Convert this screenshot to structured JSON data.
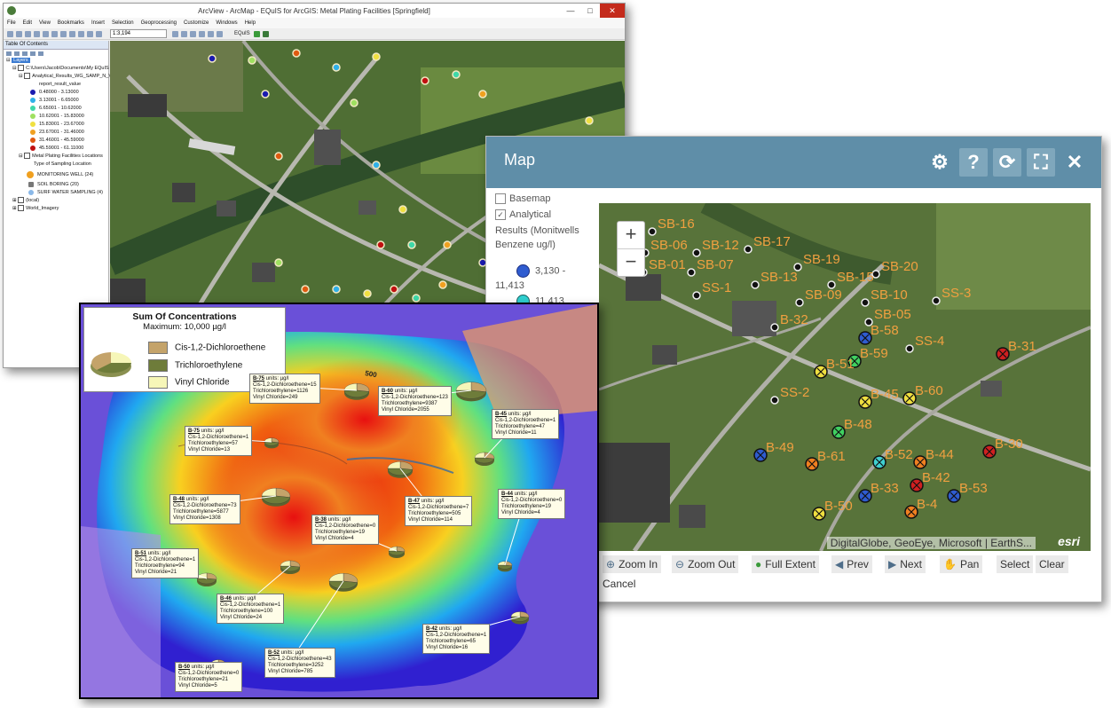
{
  "arcmap": {
    "title": "ArcView - ArcMap - EQuIS for ArcGIS: Metal Plating Facilities [Springfield]",
    "menus": [
      "File",
      "Edit",
      "View",
      "Bookmarks",
      "Insert",
      "Selection",
      "Geoprocessing",
      "Customize",
      "Windows",
      "Help"
    ],
    "scale": "1:3,194",
    "equis_label": "EQuIS",
    "toc": {
      "header": "Table Of Contents",
      "layers_label": "Layers",
      "path": "C:\\Users\\Jacob\\Documents\\My EQuIS",
      "analytical_layer": "Analytical_Results_WG_SAMP_N_Va",
      "field": "report_result_value",
      "classes": [
        {
          "range": "0.48000 - 3.13000",
          "color": "#1a1ab0"
        },
        {
          "range": "3.13001 - 6.65000",
          "color": "#2fb0e8"
        },
        {
          "range": "6.65001 - 10.62000",
          "color": "#3fd8a8"
        },
        {
          "range": "10.62001 - 15.83000",
          "color": "#9fe060"
        },
        {
          "range": "15.83001 - 23.67000",
          "color": "#f0e040"
        },
        {
          "range": "23.67001 - 31.46000",
          "color": "#f0a020"
        },
        {
          "range": "31.46001 - 45.59000",
          "color": "#e05a10"
        },
        {
          "range": "45.59001 - 61.11000",
          "color": "#c01010"
        }
      ],
      "locations_layer": "Metal Plating Facilities Locations",
      "type_field": "Type of Sampling Location",
      "location_types": [
        "MONITORING WELL (24)",
        "SOIL BORING (20)",
        "SURF WATER SAMPLING (4)"
      ],
      "other_layers": [
        "(local)",
        "World_Imagery"
      ]
    }
  },
  "map_widget": {
    "title": "Map",
    "tools": [
      "gear-icon",
      "help-icon",
      "refresh-icon",
      "fullscreen-icon",
      "close-icon"
    ],
    "legend": {
      "basemap": "Basemap",
      "analytical": "Analytical",
      "results_label": "Results (Monitwells Benzene ug/l)",
      "class1": "3,130 -",
      "class1b": "11,413",
      "class2": "11,413"
    },
    "attribution": "DigitalGlobe, GeoEye, Microsoft | EarthS...",
    "esri": "esri",
    "buttons": [
      "Zoom In",
      "Zoom Out",
      "Full Extent",
      "Prev",
      "Next",
      "Pan",
      "Select",
      "Clear",
      "Cancel"
    ],
    "sample_labels": [
      {
        "t": "SB-16"
      },
      {
        "t": "SB-06"
      },
      {
        "t": "SB-12"
      },
      {
        "t": "SB-17"
      },
      {
        "t": "SB-01"
      },
      {
        "t": "SB-07"
      },
      {
        "t": "SB-19"
      },
      {
        "t": "SB-20"
      },
      {
        "t": "SB-13"
      },
      {
        "t": "SB-15"
      },
      {
        "t": "SS-1"
      },
      {
        "t": "SB-09"
      },
      {
        "t": "SB-10"
      },
      {
        "t": "SS-3"
      },
      {
        "t": "SB-05"
      },
      {
        "t": "B-32"
      },
      {
        "t": "B-58"
      },
      {
        "t": "SS-4"
      },
      {
        "t": "B-31"
      },
      {
        "t": "B-59"
      },
      {
        "t": "B-51"
      },
      {
        "t": "SS-2"
      },
      {
        "t": "B-60"
      },
      {
        "t": "B-45"
      },
      {
        "t": "B-48"
      },
      {
        "t": "B-49"
      },
      {
        "t": "B-30"
      },
      {
        "t": "B-61"
      },
      {
        "t": "B-52"
      },
      {
        "t": "B-44"
      },
      {
        "t": "B-42"
      },
      {
        "t": "B-33"
      },
      {
        "t": "B-53"
      },
      {
        "t": "B-4"
      },
      {
        "t": "B-50"
      }
    ]
  },
  "concentration_map": {
    "title": "Sum Of Concentrations",
    "subtitle": "Maximum: 10,000 µg/l",
    "legend": [
      {
        "label": "Cis-1,2-Dichloroethene",
        "color": "#c4a36a"
      },
      {
        "label": "Trichloroethylene",
        "color": "#6e7c3a"
      },
      {
        "label": "Vinyl Chloride",
        "color": "#f6f6b8"
      }
    ],
    "contour_label": "500",
    "boxes": [
      {
        "id": "B-75",
        "units": "units:  µg/l",
        "cis": "Cis-1,2-Dichloroethene=15",
        "tce": "Trichloroethylene=1126",
        "vc": "Vinyl Chloride=249"
      },
      {
        "id": "B-75",
        "units": "units:  µg/l",
        "cis": "Cis-1,2-Dichloroethene=1",
        "tce": "Trichloroethylene=57",
        "vc": "Vinyl Chloride=13"
      },
      {
        "id": "B-60",
        "units": "units:  µg/l",
        "cis": "Cis-1,2-Dichloroethene=123",
        "tce": "Trichloroethylene=9387",
        "vc": "Vinyl Chloride=2055"
      },
      {
        "id": "B-45",
        "units": "units:  µg/l",
        "cis": "Cis-1,2-Dichloroethene=1",
        "tce": "Trichloroethylene=47",
        "vc": "Vinyl Chloride=11"
      },
      {
        "id": "B-48",
        "units": "units:  µg/l",
        "cis": "Cis-1,2-Dichloroethene=73",
        "tce": "Trichloroethylene=5877",
        "vc": "Vinyl Chloride=1308"
      },
      {
        "id": "B-47",
        "units": "units:  µg/l",
        "cis": "Cis-1,2-Dichloroethene=7",
        "tce": "Trichloroethylene=505",
        "vc": "Vinyl Chloride=114"
      },
      {
        "id": "B-44",
        "units": "units:  µg/l",
        "cis": "Cis-1,2-Dichloroethene=0",
        "tce": "Trichloroethylene=19",
        "vc": "Vinyl Chloride=4"
      },
      {
        "id": "B-38",
        "units": "units:  µg/l",
        "cis": "Cis-1,2-Dichloroethene=0",
        "tce": "Trichloroethylene=19",
        "vc": "Vinyl Chloride=4"
      },
      {
        "id": "B-51",
        "units": "units:  µg/l",
        "cis": "Cis-1,2-Dichloroethene=1",
        "tce": "Trichloroethylene=94",
        "vc": "Vinyl Chloride=21"
      },
      {
        "id": "B-46",
        "units": "units:  µg/l",
        "cis": "Cis-1,2-Dichloroethene=1",
        "tce": "Trichloroethylene=100",
        "vc": "Vinyl Chloride=24"
      },
      {
        "id": "B-42",
        "units": "units:  µg/l",
        "cis": "Cis-1,2-Dichloroethene=1",
        "tce": "Trichloroethylene=65",
        "vc": "Vinyl Chloride=16"
      },
      {
        "id": "B-52",
        "units": "units:  µg/l",
        "cis": "Cis-1,2-Dichloroethene=43",
        "tce": "Trichloroethylene=3252",
        "vc": "Vinyl Chloride=785"
      },
      {
        "id": "B-50",
        "units": "units:  µg/l",
        "cis": "Cis-1,2-Dichloroethene=0",
        "tce": "Trichloroethylene=21",
        "vc": "Vinyl Chloride=5"
      }
    ]
  }
}
